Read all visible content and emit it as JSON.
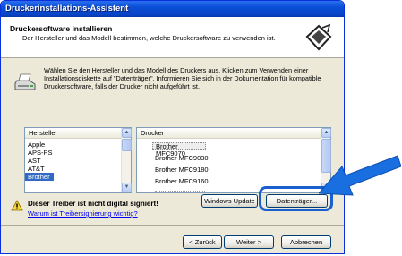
{
  "window": {
    "title": "Druckerinstallations-Assistent"
  },
  "header": {
    "title": "Druckersoftware installieren",
    "subtitle": "Der Hersteller und das Modell bestimmen, welche Druckersoftware zu verwenden ist."
  },
  "info": {
    "text": "Wählen Sie den Hersteller und das Modell des Druckers aus. Klicken zum Verwenden einer Installationsdiskette auf \"Datenträger\". Informieren Sie sich in der Dokumentation für kompatible Druckersoftware, falls der Drucker nicht aufgeführt ist."
  },
  "manufacturer_list": {
    "header": "Hersteller",
    "items": [
      "Apple",
      "APS-PS",
      "AST",
      "AT&T",
      "Brother"
    ],
    "selected": "Brother"
  },
  "printer_list": {
    "header": "Drucker",
    "items": [
      "Brother MFC9070",
      "Brother MFC9030",
      "Brother MFC9180",
      "Brother MFC9160"
    ]
  },
  "warning": {
    "text": "Dieser Treiber ist nicht digital signiert!",
    "link": "Warum ist Treibersignierung wichtig?"
  },
  "buttons": {
    "windows_update": "Windows Update",
    "datentraeger": "Datenträger...",
    "back": "< Zurück",
    "next": "Weiter >",
    "cancel": "Abbrechen"
  },
  "colors": {
    "title_bar": "#0a4ed6",
    "selection": "#316ac5",
    "callout": "#1a5fd0"
  }
}
